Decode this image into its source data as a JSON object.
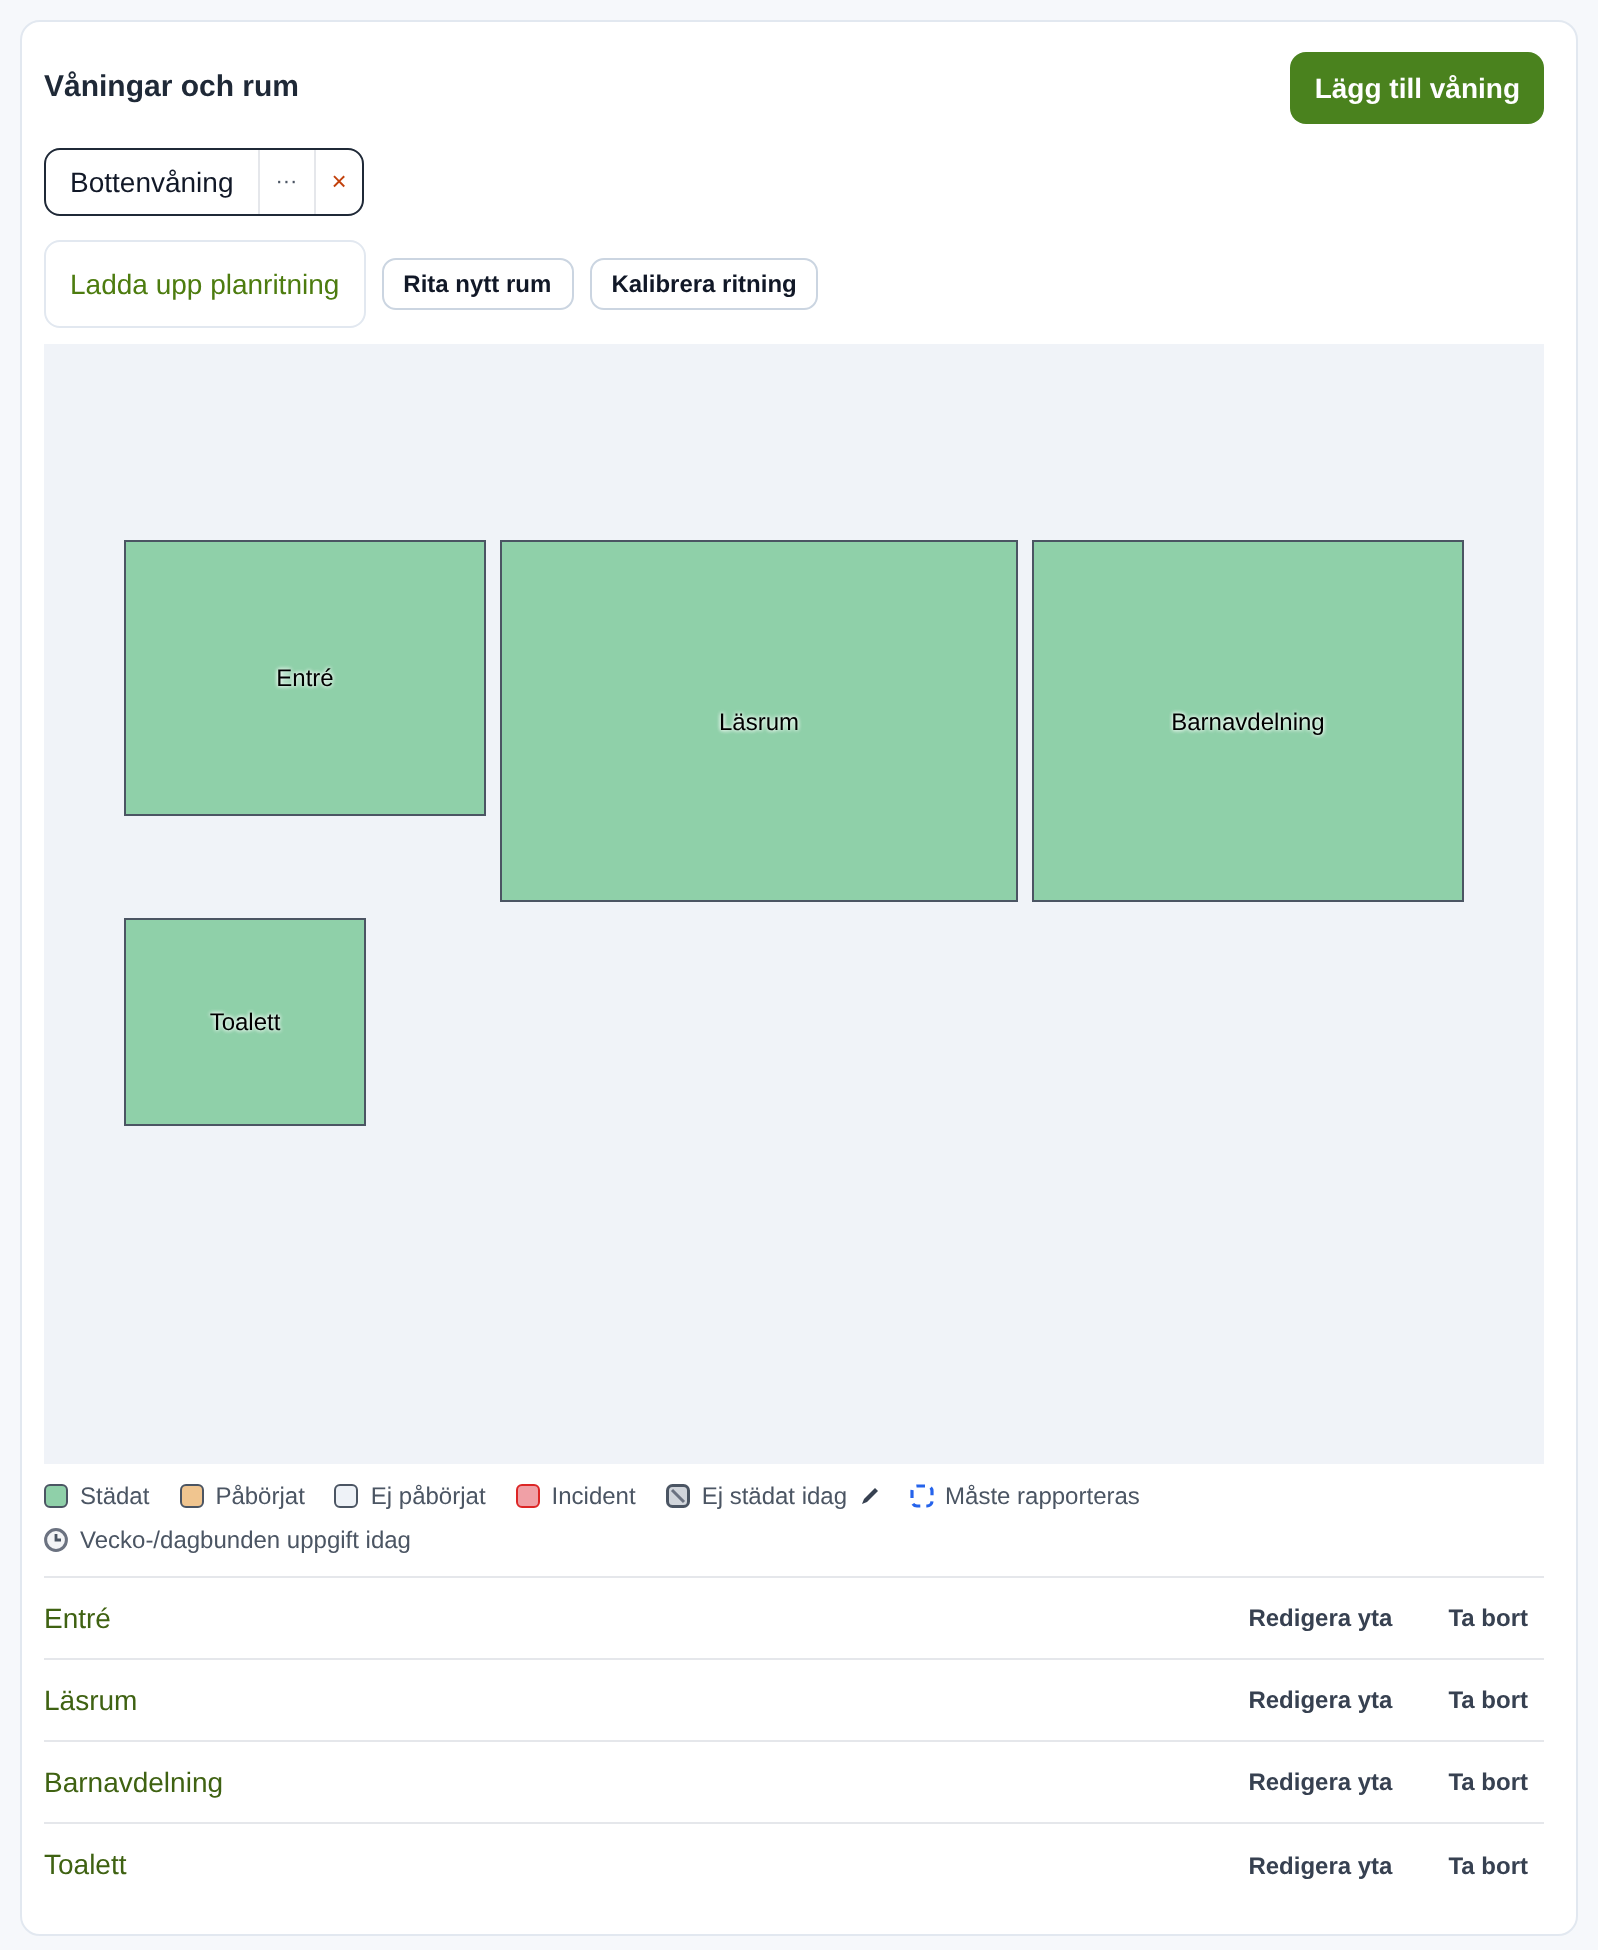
{
  "header": {
    "title": "Våningar och rum",
    "add_floor_button": "Lägg till våning"
  },
  "floors": [
    {
      "name": "Bottenvåning",
      "selected": true,
      "menu": "···",
      "remove": "×"
    }
  ],
  "toolbar": {
    "upload_button": "Ladda upp planritning",
    "draw_button": "Rita nytt rum",
    "calibrate_button": "Kalibrera ritning"
  },
  "floor_plan": {
    "rooms": [
      {
        "name": "Entré",
        "color": "#8fd0a9"
      },
      {
        "name": "Läsrum",
        "color": "#8fd0a9"
      },
      {
        "name": "Barnavdelning",
        "color": "#8fd0a9"
      },
      {
        "name": "Toalett",
        "color": "#8fd0a9"
      }
    ]
  },
  "legend": [
    {
      "kind": "swatch",
      "color": "#8fd0a9",
      "label": "Städat"
    },
    {
      "kind": "swatch",
      "color": "#f0c58f",
      "label": "Påbörjat"
    },
    {
      "kind": "swatch",
      "color": "#eef2f7",
      "label": "Ej påbörjat"
    },
    {
      "kind": "incident",
      "color": "#f0a0a6",
      "label": "Incident"
    },
    {
      "kind": "hatched",
      "label": "Ej städat idag"
    },
    {
      "kind": "dashed",
      "label": "Måste rapporteras"
    },
    {
      "kind": "clock",
      "label": "Vecko-/dagbunden uppgift idag"
    }
  ],
  "rooms": [
    {
      "name": "Entré",
      "edit_button": "Redigera yta",
      "delete_button": "Ta bort"
    },
    {
      "name": "Läsrum",
      "edit_button": "Redigera yta",
      "delete_button": "Ta bort"
    },
    {
      "name": "Barnavdelning",
      "edit_button": "Redigera yta",
      "delete_button": "Ta bort"
    },
    {
      "name": "Toalett",
      "edit_button": "Redigera yta",
      "delete_button": "Ta bort"
    }
  ]
}
